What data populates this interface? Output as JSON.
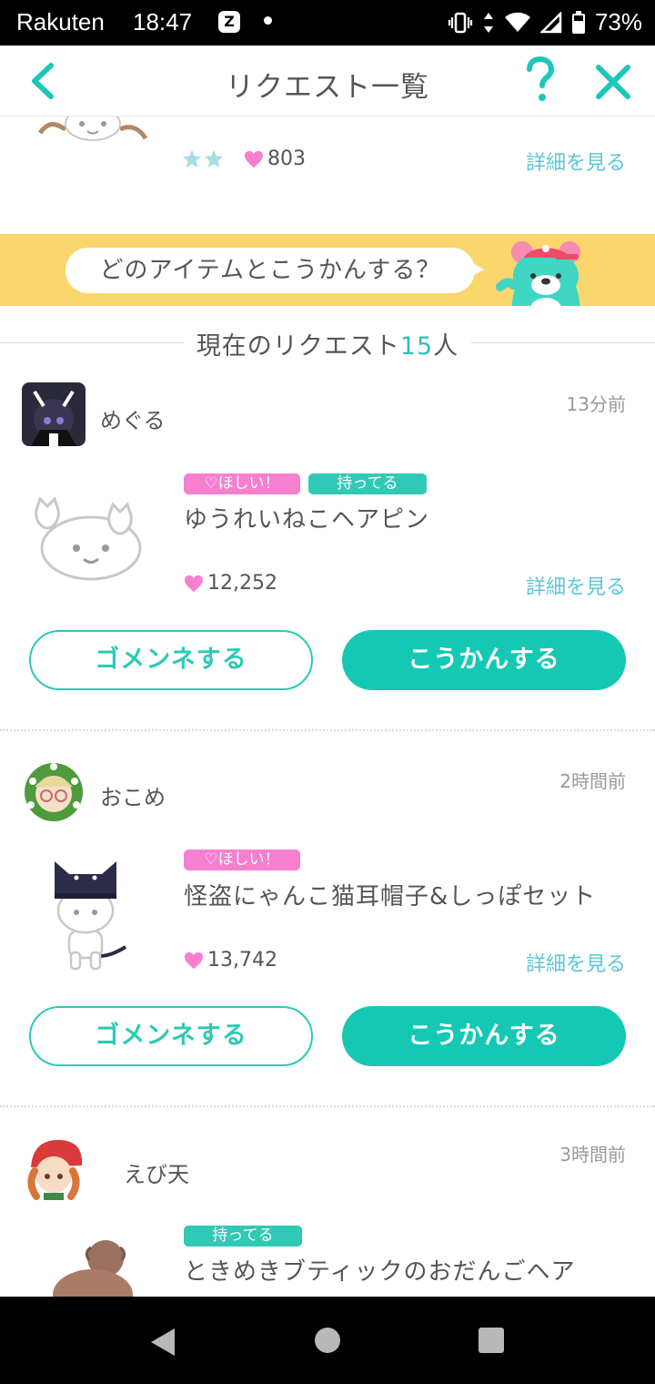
{
  "status_bar": {
    "carrier": "Rakuten",
    "time": "18:47",
    "battery": "73%"
  },
  "header": {
    "title": "リクエスト一覧"
  },
  "previous_card": {
    "likes": "803",
    "detail_label": "詳細を見る"
  },
  "banner": {
    "text": "どのアイテムとこうかんする？"
  },
  "section": {
    "label_prefix": "現在のリクエスト",
    "count": "15",
    "label_suffix": "人"
  },
  "requests": [
    {
      "username": "めぐる",
      "ago": "13分前",
      "tag_want": "♡ほしい！",
      "tag_have": "持ってる",
      "item_name": "ゆうれいねこヘアピン",
      "likes": "12,252",
      "detail_label": "詳細を見る",
      "decline_label": "ゴメンネする",
      "accept_label": "こうかんする"
    },
    {
      "username": "おこめ",
      "ago": "2時間前",
      "tag_want": "♡ほしい！",
      "item_name": "怪盗にゃんこ猫耳帽子&しっぽセット",
      "likes": "13,742",
      "detail_label": "詳細を見る",
      "decline_label": "ゴメンネする",
      "accept_label": "こうかんする"
    },
    {
      "username": "えび天",
      "ago": "3時間前",
      "tag_have": "持ってる",
      "item_name": "ときめきブティックのおだんごヘア"
    }
  ],
  "colors": {
    "accent": "#14c8b4",
    "link": "#5cc6d6",
    "heart": "#f77fcf",
    "banner": "#fbd66d"
  },
  "icons": [
    "back-chevron-icon",
    "help-icon",
    "close-icon",
    "heart-icon",
    "star-icon",
    "bear-mascot"
  ]
}
